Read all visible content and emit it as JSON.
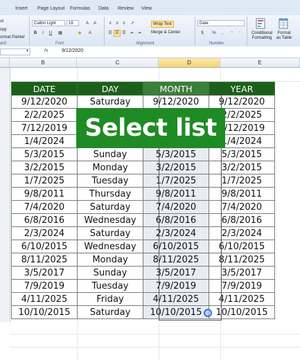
{
  "ribbon": {
    "tabs": [
      "Insert",
      "Page Layout",
      "Formulas",
      "Data",
      "Review",
      "View"
    ],
    "clipboard": {
      "cut": "ut",
      "copy": "opy",
      "format_painter": "ormat Painter",
      "group": "ard"
    },
    "font": {
      "name": "Calibri Light",
      "size": "16",
      "group": "Font"
    },
    "alignment": {
      "wrap_text": "Wrap Text",
      "merge_center": "Merge & Center",
      "group": "Alignment"
    },
    "number": {
      "format": "Date",
      "group": "Number",
      "currency": "$",
      "percent": "%",
      "comma": ","
    },
    "styles": {
      "conditional": "Conditional Formatting",
      "format_table": "Format as Table"
    }
  },
  "formula_bar": {
    "fx": "fx",
    "value": "9/12/2020"
  },
  "columns": [
    "B",
    "C",
    "D",
    "E"
  ],
  "active_column": "D",
  "table": {
    "headers": [
      "DATE",
      "DAY",
      "MONTH",
      "YEAR"
    ],
    "rows": [
      [
        "9/12/2020",
        "Saturday",
        "9/12/2020",
        "9/12/2020"
      ],
      [
        "2/2/2025",
        "",
        "",
        "2/2/2025"
      ],
      [
        "7/12/2019",
        "",
        "",
        "7/12/2019"
      ],
      [
        "1/4/2024",
        "",
        "",
        "1/4/2024"
      ],
      [
        "5/3/2015",
        "Sunday",
        "5/3/2015",
        "5/3/2015"
      ],
      [
        "3/2/2015",
        "Monday",
        "3/2/2015",
        "3/2/2015"
      ],
      [
        "1/7/2025",
        "Tuesday",
        "1/7/2025",
        "1/7/2025"
      ],
      [
        "9/8/2011",
        "Thursday",
        "9/8/2011",
        "9/8/2011"
      ],
      [
        "7/4/2020",
        "Saturday",
        "7/4/2020",
        "7/4/2020"
      ],
      [
        "6/8/2016",
        "Wednesday",
        "6/8/2016",
        "6/8/2016"
      ],
      [
        "2/3/2024",
        "Saturday",
        "2/3/2024",
        "2/3/2024"
      ],
      [
        "6/10/2015",
        "Wednesday",
        "6/10/2015",
        "6/10/2015"
      ],
      [
        "8/11/2025",
        "Monday",
        "8/11/2025",
        "8/11/2025"
      ],
      [
        "3/5/2017",
        "Sunday",
        "3/5/2017",
        "3/5/2017"
      ],
      [
        "7/9/2019",
        "Tuesday",
        "7/9/2019",
        "7/9/2019"
      ],
      [
        "4/11/2025",
        "Friday",
        "4/11/2025",
        "4/11/2025"
      ],
      [
        "10/10/2015",
        "Saturday",
        "10/10/2015",
        "10/10/2015"
      ]
    ]
  },
  "banner": {
    "text": "Select list"
  },
  "colors": {
    "header_green": "#1c5e1c",
    "banner_green": "#1f8b24",
    "selection": "#e8ecf3"
  }
}
